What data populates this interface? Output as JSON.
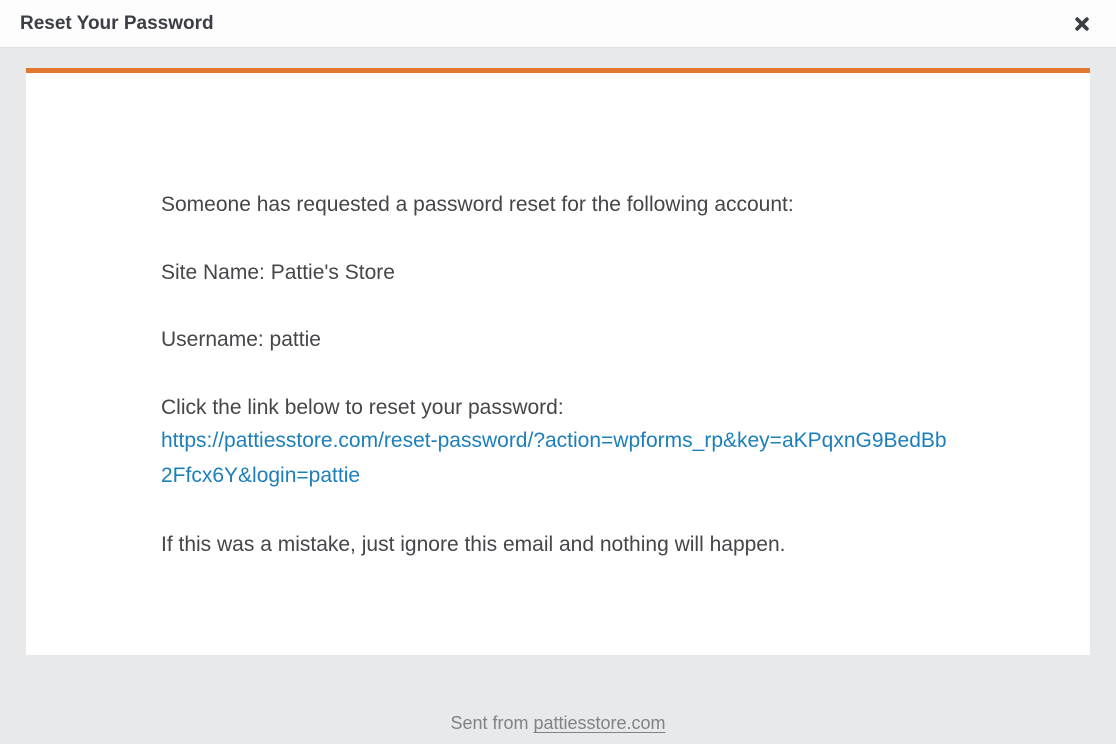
{
  "header": {
    "title": "Reset Your Password"
  },
  "email": {
    "intro": "Someone has requested a password reset for the following account:",
    "site_line": "Site Name: Pattie's Store",
    "username_line": "Username: pattie",
    "click_line": "Click the link below to reset your password:",
    "reset_url": "https://pattiesstore.com/reset-password/?action=wpforms_rp&key=aKPqxnG9BedBb2Ffcx6Y&login=pattie",
    "mistake_line": "If this was a mistake, just ignore this email and nothing will happen."
  },
  "footer": {
    "sent_from_prefix": "Sent from ",
    "domain": "pattiesstore.com"
  },
  "colors": {
    "accent": "#e27730",
    "link": "#1c7fba"
  }
}
